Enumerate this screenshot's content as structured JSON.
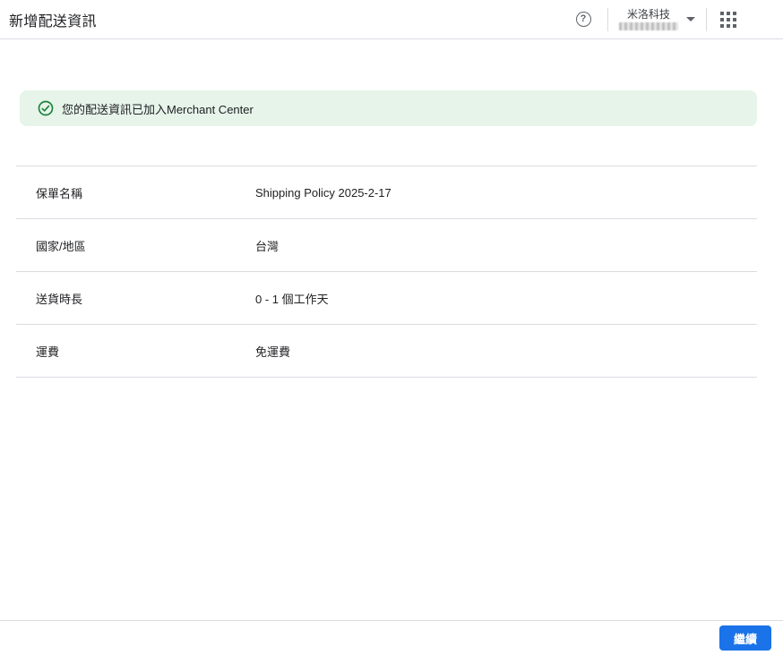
{
  "header": {
    "title": "新增配送資訊",
    "account": {
      "name": "米洛科技",
      "id_redacted": true
    },
    "icons": {
      "help": "help-circle-icon",
      "account_caret": "chevron-down-icon",
      "apps": "apps-grid-icon"
    }
  },
  "banner": {
    "icon": "check-circle-icon",
    "message": "您的配送資訊已加入Merchant Center"
  },
  "details": {
    "rows": [
      {
        "label": "保單名稱",
        "value": "Shipping Policy 2025-2-17"
      },
      {
        "label": "國家/地區",
        "value": "台灣"
      },
      {
        "label": "送貨時長",
        "value": "0 - 1 個工作天"
      },
      {
        "label": "運費",
        "value": "免運費"
      }
    ]
  },
  "footer": {
    "continue_label": "繼續"
  },
  "colors": {
    "accent_blue": "#1a73e8",
    "success_green": "#188038",
    "banner_bg": "#e6f4ea",
    "divider": "#dadce0",
    "icon_gray": "#5f6368",
    "text_primary": "#202124"
  }
}
